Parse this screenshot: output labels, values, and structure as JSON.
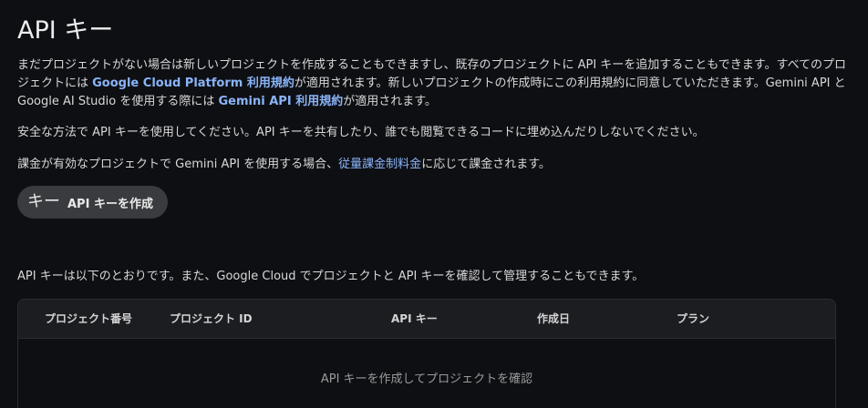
{
  "page": {
    "title": "API キー"
  },
  "intro": {
    "text_1": "まだプロジェクトがない場合は新しいプロジェクトを作成することもできますし、既存のプロジェクトに API キーを追加することもできます。すべてのプロジェクトには ",
    "link_1": "Google Cloud Platform 利用規約",
    "text_2": "が適用されます。新しいプロジェクトの作成時にこの利用規約に同意していただきます。Gemini API と Google AI Studio を使用する際には ",
    "link_2": "Gemini API 利用規約",
    "text_3": "が適用されます。"
  },
  "security_note": "安全な方法で API キーを使用してください。API キーを共有したり、誰でも閲覧できるコードに埋め込んだりしないでください。",
  "billing": {
    "text_1": "課金が有効なプロジェクトで Gemini API を使用する場合、",
    "link": "従量課金制料金",
    "text_2": "に応じて課金されます。"
  },
  "create_button": {
    "icon": "キー",
    "label": "API キーを作成"
  },
  "list_intro": "API キーは以下のとおりです。また、Google Cloud でプロジェクトと API キーを確認して管理することもできます。",
  "table": {
    "columns": [
      "プロジェクト番号",
      "プロジェクト ID",
      "API キー",
      "作成日",
      "プラン"
    ],
    "empty_message": "API キーを作成してプロジェクトを確認"
  },
  "colors": {
    "background": "#0e0f13",
    "link": "#8ab4f8",
    "button_bg": "#3a3b3e",
    "table_header_bg": "#1c1d21"
  }
}
